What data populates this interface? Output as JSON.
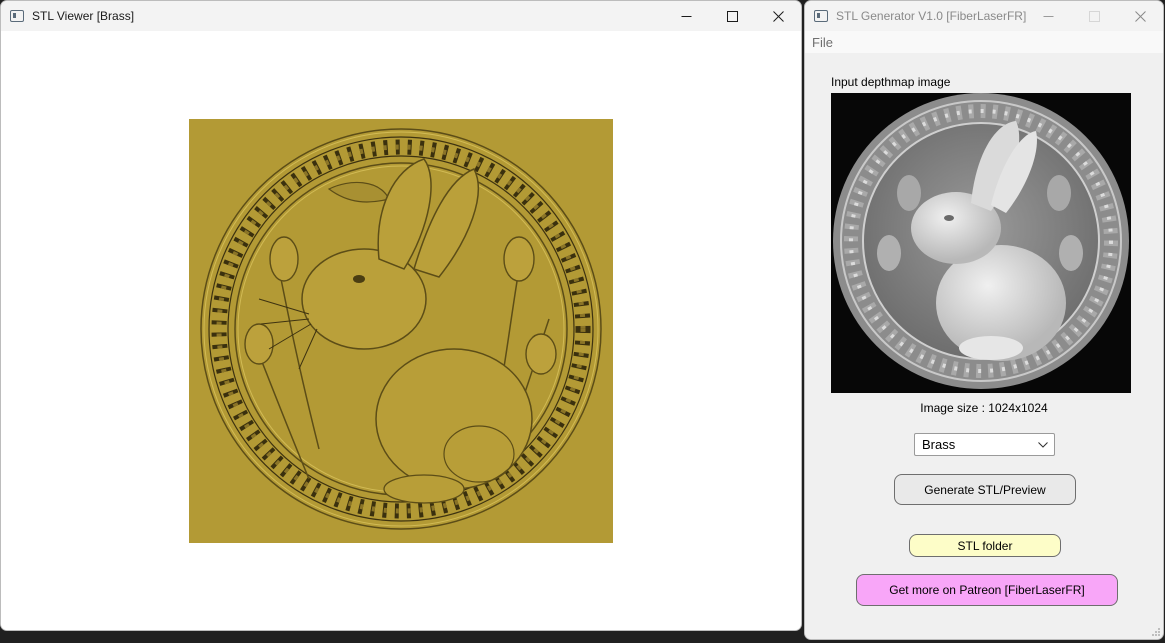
{
  "viewer": {
    "title": "STL Viewer [Brass]",
    "material_color": "#b39a35",
    "background_color": "#ffffff"
  },
  "generator": {
    "title": "STL Generator V1.0 [FiberLaserFR]",
    "menu": [
      "File"
    ],
    "input_label": "Input depthmap image",
    "image_size_text": "Image size : 1024x1024",
    "material_select": {
      "selected": "Brass"
    },
    "generate_button": "Generate STL/Preview",
    "stl_folder_button": "STL folder",
    "patreon_button": "Get more on Patreon [FiberLaserFR]",
    "colors": {
      "stl_folder_bg": "#fdfdc8",
      "patreon_bg": "#f8a6f8"
    }
  },
  "icons": {
    "app": "app-window-icon",
    "minimize": "minimize-icon",
    "maximize": "maximize-icon",
    "close": "close-icon",
    "dropdown": "chevron-down-icon",
    "resize": "resize-grip-icon"
  }
}
